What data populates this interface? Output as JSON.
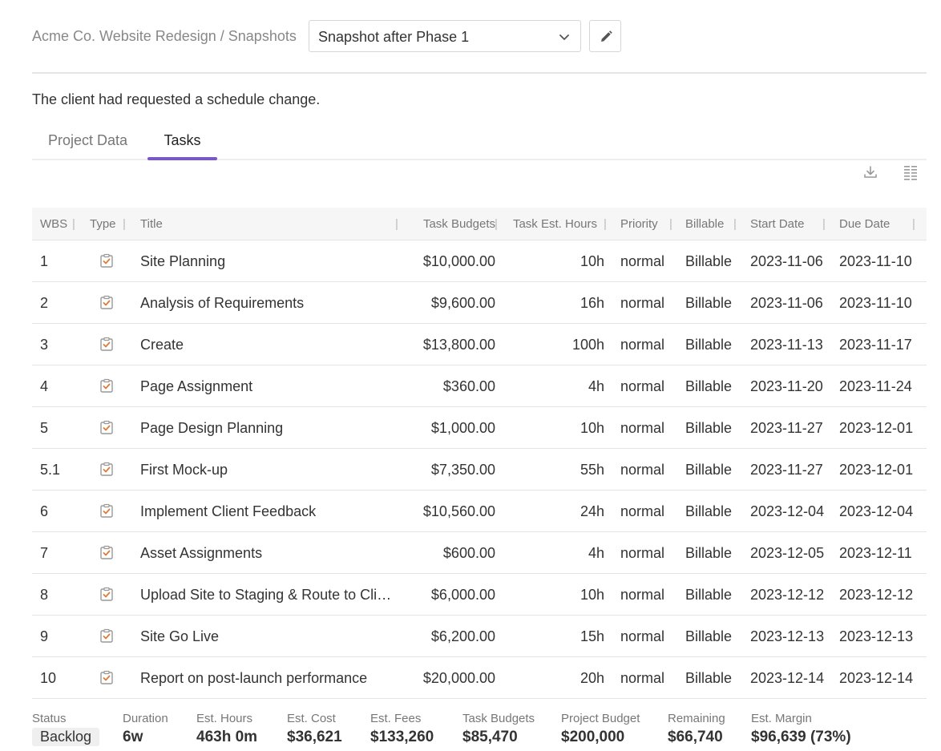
{
  "header": {
    "breadcrumb": "Acme Co. Website Redesign / Snapshots",
    "snapshot_select_value": "Snapshot after Phase 1",
    "description": "The client had requested a schedule change."
  },
  "tabs": [
    {
      "label": "Project Data",
      "active": false
    },
    {
      "label": "Tasks",
      "active": true
    }
  ],
  "colors": {
    "accent": "#7a57c8",
    "task_icon": "#e07b39"
  },
  "table": {
    "columns": [
      "WBS",
      "Type",
      "Title",
      "Task Budgets",
      "Task Est. Hours",
      "Priority",
      "Billable",
      "Start Date",
      "Due Date"
    ],
    "rows": [
      {
        "wbs": "1",
        "type": "task-icon",
        "title": "Site Planning",
        "budget": "$10,000.00",
        "hours": "10h",
        "priority": "normal",
        "billable": "Billable",
        "start": "2023-11-06",
        "due": "2023-11-10"
      },
      {
        "wbs": "2",
        "type": "task-icon",
        "title": "Analysis of Requirements",
        "budget": "$9,600.00",
        "hours": "16h",
        "priority": "normal",
        "billable": "Billable",
        "start": "2023-11-06",
        "due": "2023-11-10"
      },
      {
        "wbs": "3",
        "type": "task-icon",
        "title": "Create",
        "budget": "$13,800.00",
        "hours": "100h",
        "priority": "normal",
        "billable": "Billable",
        "start": "2023-11-13",
        "due": "2023-11-17"
      },
      {
        "wbs": "4",
        "type": "task-icon",
        "title": "Page Assignment",
        "budget": "$360.00",
        "hours": "4h",
        "priority": "normal",
        "billable": "Billable",
        "start": "2023-11-20",
        "due": "2023-11-24"
      },
      {
        "wbs": "5",
        "type": "task-icon",
        "title": "Page Design Planning",
        "budget": "$1,000.00",
        "hours": "10h",
        "priority": "normal",
        "billable": "Billable",
        "start": "2023-11-27",
        "due": "2023-12-01"
      },
      {
        "wbs": "5.1",
        "type": "task-icon",
        "title": "First Mock-up",
        "budget": "$7,350.00",
        "hours": "55h",
        "priority": "normal",
        "billable": "Billable",
        "start": "2023-11-27",
        "due": "2023-12-01"
      },
      {
        "wbs": "6",
        "type": "task-icon",
        "title": "Implement Client Feedback",
        "budget": "$10,560.00",
        "hours": "24h",
        "priority": "normal",
        "billable": "Billable",
        "start": "2023-12-04",
        "due": "2023-12-04"
      },
      {
        "wbs": "7",
        "type": "task-icon",
        "title": "Asset Assignments",
        "budget": "$600.00",
        "hours": "4h",
        "priority": "normal",
        "billable": "Billable",
        "start": "2023-12-05",
        "due": "2023-12-11"
      },
      {
        "wbs": "8",
        "type": "task-icon",
        "title": "Upload Site to Staging & Route to Clie...",
        "budget": "$6,000.00",
        "hours": "10h",
        "priority": "normal",
        "billable": "Billable",
        "start": "2023-12-12",
        "due": "2023-12-12"
      },
      {
        "wbs": "9",
        "type": "task-icon",
        "title": "Site Go Live",
        "budget": "$6,200.00",
        "hours": "15h",
        "priority": "normal",
        "billable": "Billable",
        "start": "2023-12-13",
        "due": "2023-12-13"
      },
      {
        "wbs": "10",
        "type": "task-icon",
        "title": "Report on post-launch performance",
        "budget": "$20,000.00",
        "hours": "20h",
        "priority": "normal",
        "billable": "Billable",
        "start": "2023-12-14",
        "due": "2023-12-14"
      }
    ]
  },
  "summary": [
    {
      "label": "Status",
      "value": "Backlog"
    },
    {
      "label": "Duration",
      "value": "6w"
    },
    {
      "label": "Est. Hours",
      "value": "463h 0m"
    },
    {
      "label": "Est. Cost",
      "value": "$36,621"
    },
    {
      "label": "Est. Fees",
      "value": "$133,260"
    },
    {
      "label": "Task Budgets",
      "value": "$85,470"
    },
    {
      "label": "Project Budget",
      "value": "$200,000"
    },
    {
      "label": "Remaining",
      "value": "$66,740"
    },
    {
      "label": "Est. Margin",
      "value": "$96,639 (73%)"
    }
  ]
}
